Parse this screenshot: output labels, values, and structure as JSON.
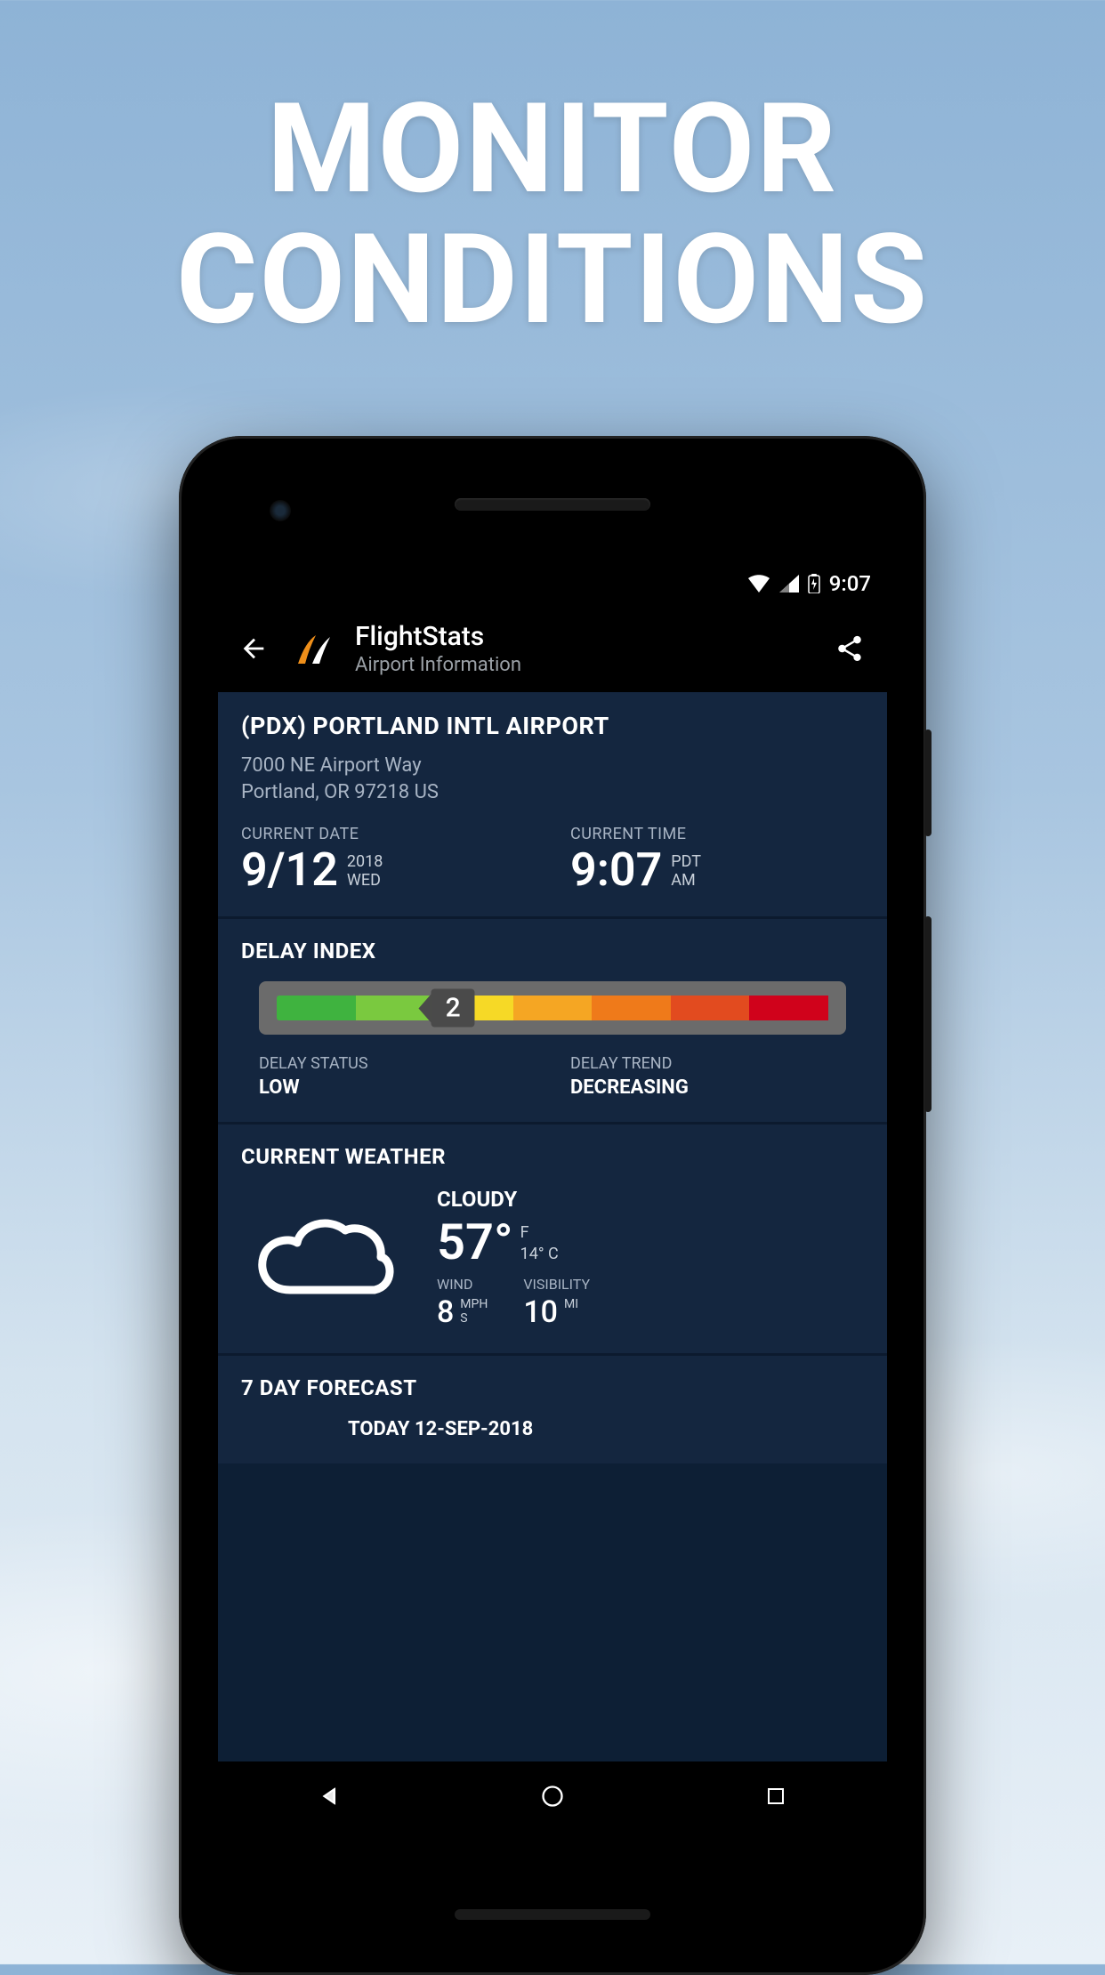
{
  "promo": {
    "line1": "MONITOR",
    "line2": "CONDITIONS"
  },
  "statusbar": {
    "time": "9:07"
  },
  "appbar": {
    "title": "FlightStats",
    "subtitle": "Airport Information"
  },
  "airport": {
    "name": "(PDX) PORTLAND INTL AIRPORT",
    "address_line1": "7000 NE Airport Way",
    "address_line2": "Portland, OR 97218 US",
    "date_label": "CURRENT DATE",
    "date_main": "9/12",
    "date_year": "2018",
    "date_dow": "WED",
    "time_label": "CURRENT TIME",
    "time_main": "9:07",
    "time_zone": "PDT",
    "time_ampm": "AM"
  },
  "delay": {
    "title": "DELAY INDEX",
    "value": "2",
    "status_label": "DELAY STATUS",
    "status_value": "LOW",
    "trend_label": "DELAY TREND",
    "trend_value": "DECREASING",
    "colors": [
      "#3fb33f",
      "#7ac93f",
      "#f6d926",
      "#f5a623",
      "#ef7a1a",
      "#e24b1f",
      "#d0021b"
    ],
    "marker_left_pct": 32
  },
  "weather": {
    "title": "CURRENT WEATHER",
    "condition": "CLOUDY",
    "temp_f": "57°",
    "temp_f_unit": "F",
    "temp_c": "14° C",
    "wind_label": "WIND",
    "wind_value": "8",
    "wind_unit_top": "MPH",
    "wind_unit_bot": "S",
    "vis_label": "VISIBILITY",
    "vis_value": "10",
    "vis_unit": "MI"
  },
  "forecast": {
    "title": "7 DAY FORECAST",
    "today": "TODAY 12-SEP-2018"
  }
}
